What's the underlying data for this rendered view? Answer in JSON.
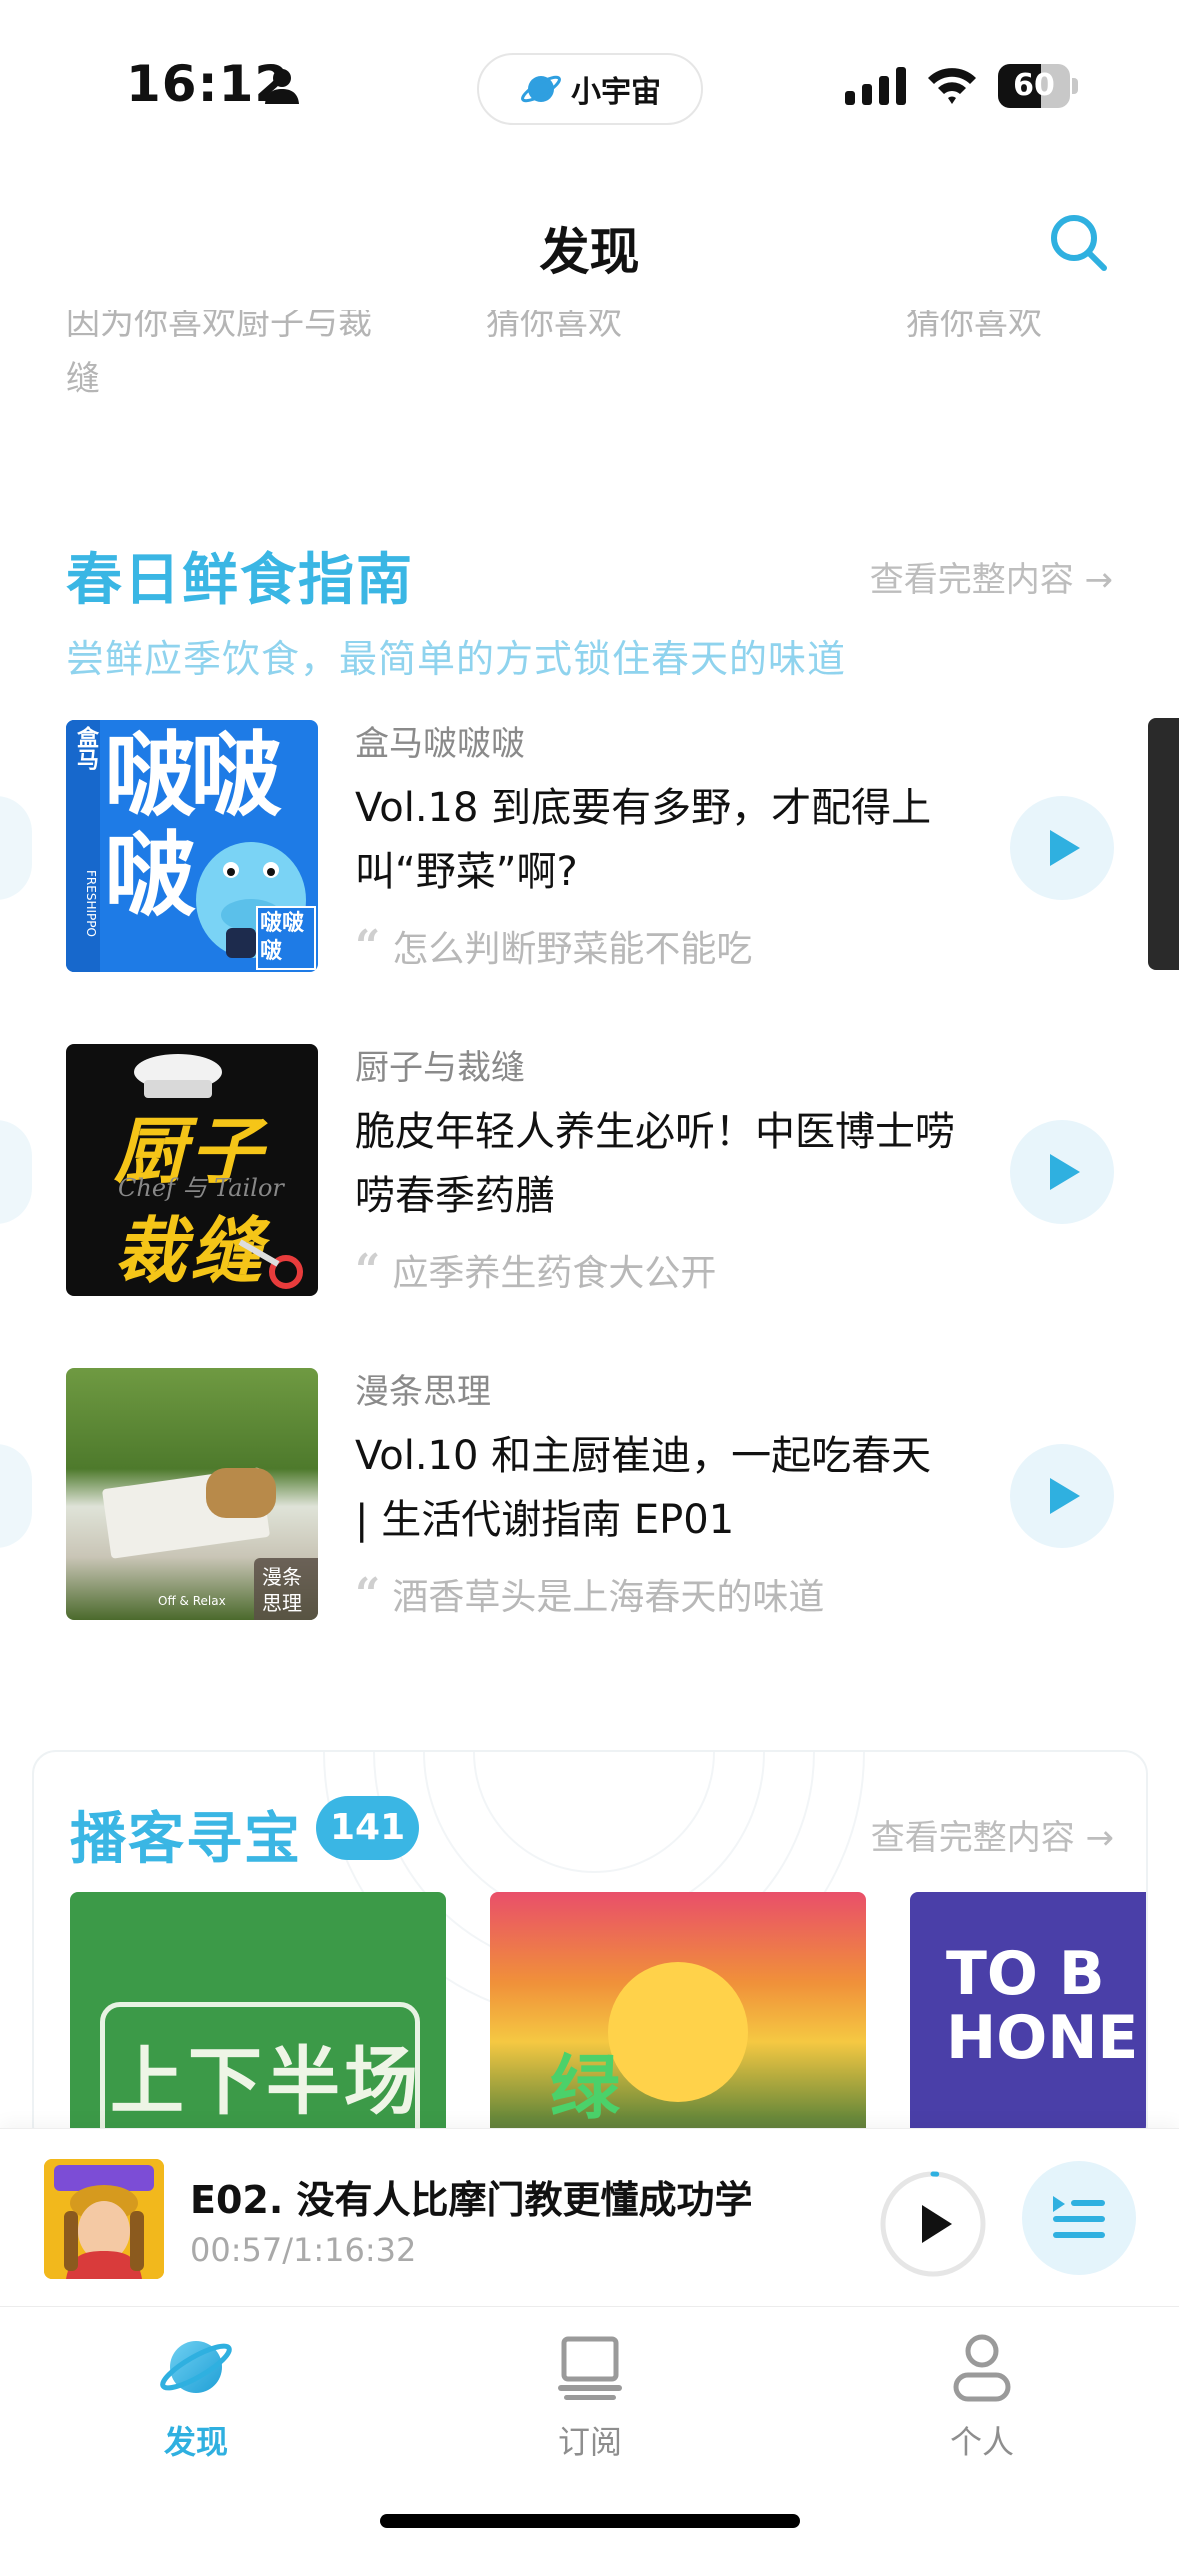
{
  "status_bar": {
    "time": "16:12",
    "island_label": "小宇宙",
    "battery": "60",
    "battery_level": 0.6
  },
  "header": {
    "title": "发现"
  },
  "reasons": [
    {
      "line1": "因为你喜欢厨子与裁",
      "line2": "缝"
    },
    {
      "line1": "猜你喜欢",
      "line2": ""
    },
    {
      "line1": "猜你喜欢",
      "line2": ""
    }
  ],
  "spring_section": {
    "title": "春日鲜食指南",
    "more": "查看完整内容 →",
    "subtitle": "尝鲜应季饮食，最简单的方式锁住春天的味道",
    "episodes": [
      {
        "podcast": "盒马啵啵啵",
        "title": "Vol.18 到底要有多野，才配得上叫“野菜”啊?",
        "quote": "怎么判断野菜能不能吃",
        "cover_text": "啵啵啵",
        "cover_side": "盒马",
        "cover_brand": "FRESHIPPO",
        "cover_tag": "啵啵啵"
      },
      {
        "podcast": "厨子与裁缝",
        "title": "脆皮年轻人养生必听！中医博士唠唠春季药膳",
        "quote": "应季养生药食大公开",
        "cover_line1": "厨子",
        "cover_line2": "裁缝",
        "cover_mid": "Chef 与 Tailor"
      },
      {
        "podcast": "漫条思理",
        "title": "Vol.10 和主厨崔迪，一起吃春天 | 生活代谢指南 EP01",
        "quote": "酒香草头是上海春天的味道",
        "cover_tag": "漫条思理",
        "cover_brand": "Off & Relax"
      }
    ]
  },
  "treasure_section": {
    "title": "播客寻宝",
    "badge": "141",
    "more": "查看完整内容 →",
    "cards": [
      {
        "text": "上下半场"
      },
      {
        "text": "绿洲"
      },
      {
        "text": "TO B HONE"
      }
    ]
  },
  "mini_player": {
    "title": "E02. 没有人比摩门教更懂成功学",
    "time": "00:57/1:16:32",
    "progress": 0.012
  },
  "tabs": [
    {
      "label": "发现",
      "icon": "planet-icon",
      "active": true
    },
    {
      "label": "订阅",
      "icon": "subscribe-icon",
      "active": false
    },
    {
      "label": "个人",
      "icon": "person-icon",
      "active": false
    }
  ],
  "colors": {
    "accent": "#3ab6e4",
    "subtitle": "#8fd3ee"
  }
}
